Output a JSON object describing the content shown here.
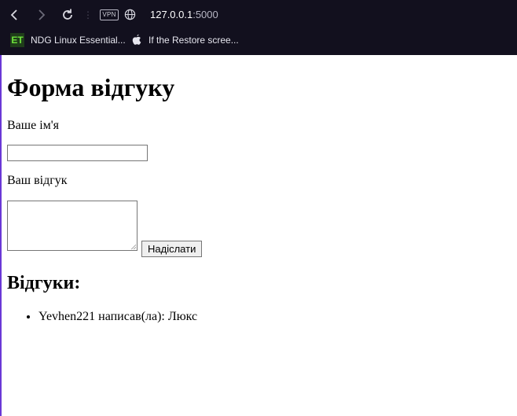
{
  "browser": {
    "url_host": "127.0.0.1",
    "url_port": ":5000",
    "vpn_label": "VPN",
    "icons": {
      "back": "chevron-left-icon",
      "forward": "chevron-right-icon",
      "reload": "reload-icon",
      "site_info": "globe-icon"
    },
    "bookmarks": [
      {
        "label": "NDG Linux Essential...",
        "icon": "ndg-icon",
        "icon_text": "ET"
      },
      {
        "label": "If the Restore scree...",
        "icon": "apple-icon"
      }
    ],
    "colors": {
      "toolbar_bg": "#12101e",
      "accent_edge": "#6a38d6"
    }
  },
  "page": {
    "title": "Форма відгуку",
    "form": {
      "name_label": "Ваше ім'я",
      "name_value": "",
      "review_label": "Ваш відгук",
      "review_value": "",
      "submit_label": "Надіслати"
    },
    "reviews_heading": "Відгуки:",
    "reviews": [
      "Yevhen221 написав(ла): Люкс"
    ]
  }
}
